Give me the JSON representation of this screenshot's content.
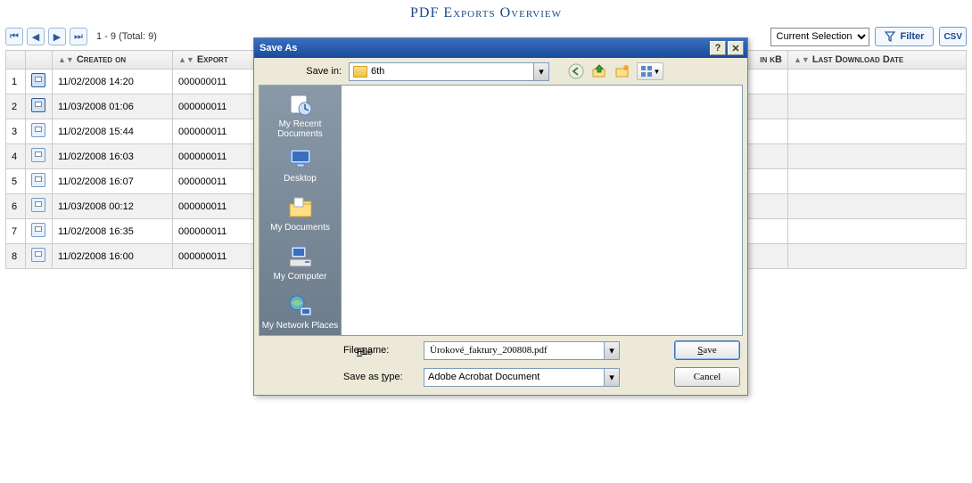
{
  "page": {
    "title": "PDF Exports Overview",
    "pager": "1 - 9 (Total: 9)",
    "selection_filter_value": "Current Selection",
    "filter_button": "Filter",
    "csv_button": "CSV"
  },
  "grid": {
    "columns": {
      "created_on": "Created on",
      "export": "Export",
      "in_kb": "in kB",
      "last_download": "Last Download Date"
    },
    "rows": [
      {
        "n": "1",
        "created": "11/02/2008 14:20",
        "export": "000000011",
        "active": true
      },
      {
        "n": "2",
        "created": "11/03/2008 01:06",
        "export": "000000011",
        "active": true
      },
      {
        "n": "3",
        "created": "11/02/2008 15:44",
        "export": "000000011",
        "active": false
      },
      {
        "n": "4",
        "created": "11/02/2008 16:03",
        "export": "000000011",
        "active": false
      },
      {
        "n": "5",
        "created": "11/02/2008 16:07",
        "export": "000000011",
        "active": false
      },
      {
        "n": "6",
        "created": "11/03/2008 00:12",
        "export": "000000011",
        "active": false
      },
      {
        "n": "7",
        "created": "11/02/2008 16:35",
        "export": "000000011",
        "active": false
      },
      {
        "n": "8",
        "created": "11/02/2008 16:00",
        "export": "000000011",
        "active": false
      }
    ]
  },
  "dialog": {
    "title": "Save As",
    "save_in_label": "Save in:",
    "save_in_value": "6th",
    "places": {
      "recent": "My Recent Documents",
      "desktop": "Desktop",
      "mydocs": "My Documents",
      "mycomp": "My Computer",
      "netplaces": "My Network Places"
    },
    "filename_label": "File name:",
    "filename_value": "Úrokové_faktury_200808.pdf",
    "type_label": "Save as type:",
    "type_value": "Adobe Acrobat Document",
    "save_button": "Save",
    "cancel_button": "Cancel"
  }
}
